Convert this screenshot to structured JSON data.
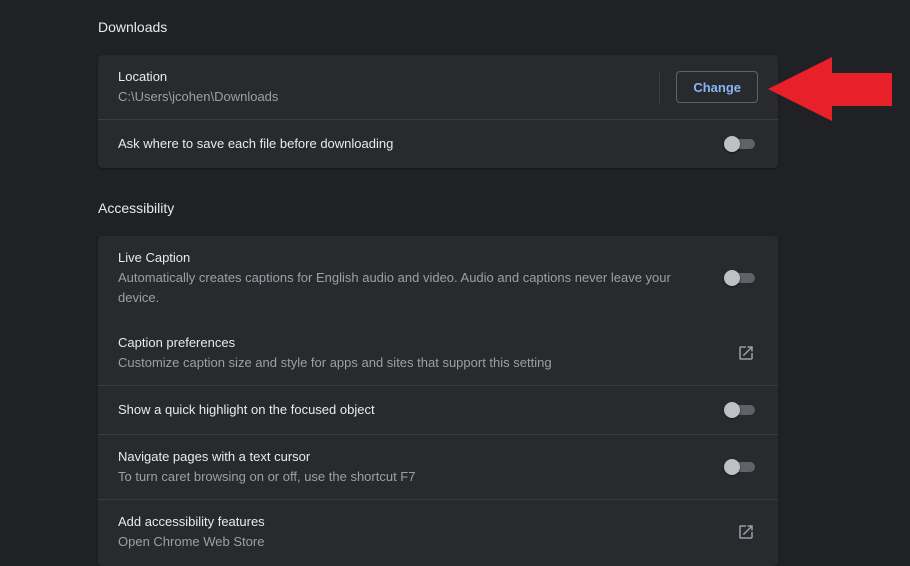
{
  "downloads": {
    "title": "Downloads",
    "location": {
      "label": "Location",
      "value": "C:\\Users\\jcohen\\Downloads",
      "button_label": "Change"
    },
    "ask_where": {
      "label": "Ask where to save each file before downloading",
      "enabled": false
    }
  },
  "accessibility": {
    "title": "Accessibility",
    "live_caption": {
      "label": "Live Caption",
      "description": "Automatically creates captions for English audio and video. Audio and captions never leave your device.",
      "enabled": false
    },
    "caption_preferences": {
      "label": "Caption preferences",
      "description": "Customize caption size and style for apps and sites that support this setting",
      "icon": "external-link-icon"
    },
    "focus_highlight": {
      "label": "Show a quick highlight on the focused object",
      "enabled": false
    },
    "caret_browsing": {
      "label": "Navigate pages with a text cursor",
      "description": "To turn caret browsing on or off, use the shortcut F7",
      "enabled": false
    },
    "add_features": {
      "label": "Add accessibility features",
      "description": "Open Chrome Web Store",
      "icon": "external-link-icon"
    }
  },
  "colors": {
    "background": "#202124",
    "card": "#292a2d",
    "accent": "#8ab4f8",
    "annotation_arrow": "#e8202a"
  }
}
